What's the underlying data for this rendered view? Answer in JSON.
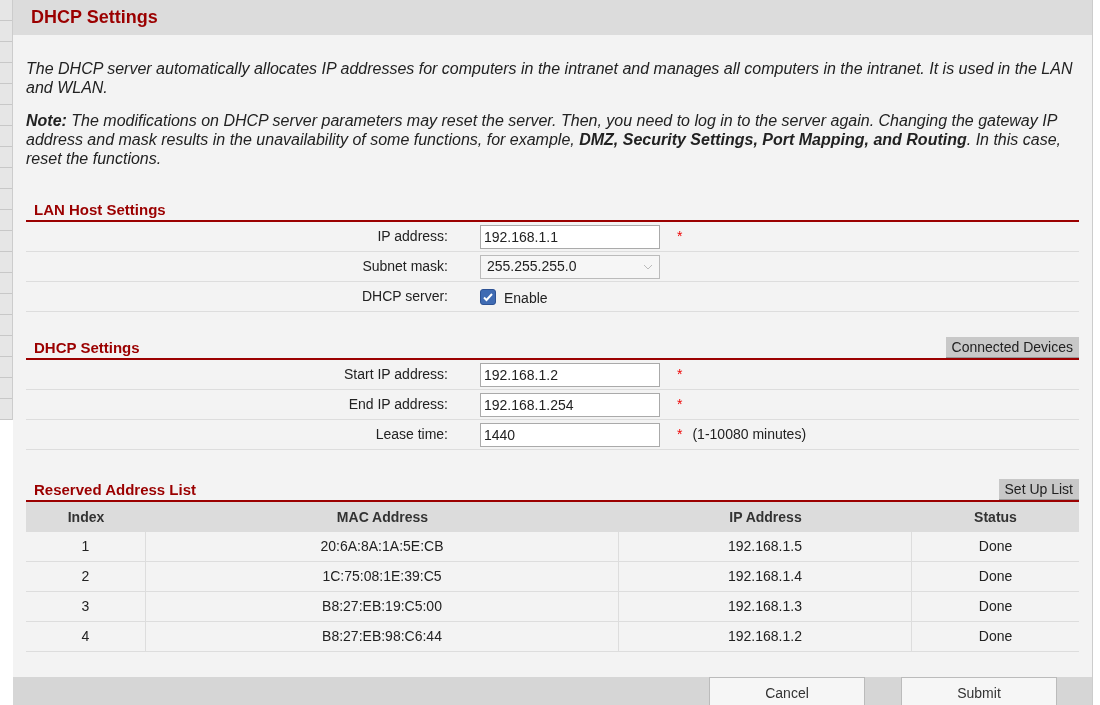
{
  "page_title": "DHCP Settings",
  "intro": "The DHCP server automatically allocates IP addresses for computers in the intranet and manages all computers in the intranet. It is used in the LAN and WLAN.",
  "note": "**Note:** The modifications on DHCP server parameters may reset the server. Then, you need to log in to the server again. Changing the gateway IP address and mask results in the unavailability of some functions, for example, **DMZ, Security Settings, Port Mapping, and Routing**. In this case, reset the functions.",
  "sections": [
    {
      "title": "LAN Host Settings",
      "fields": [
        {
          "kind": "text",
          "label": "IP address:",
          "value": "192.168.1.1",
          "mark": "*"
        },
        {
          "kind": "select",
          "label": "Subnet mask:",
          "value": "255.255.255.0"
        },
        {
          "kind": "checkbox",
          "label": "DHCP server:",
          "value": "Enable",
          "checked": true
        }
      ]
    },
    {
      "title": "DHCP Settings",
      "action": "Connected Devices",
      "fields": [
        {
          "kind": "text",
          "label": "Start IP address:",
          "value": "192.168.1.2",
          "mark": "*"
        },
        {
          "kind": "text",
          "label": "End IP address:",
          "value": "192.168.1.254",
          "mark": "*"
        },
        {
          "kind": "text",
          "label": "Lease time:",
          "value": "1440",
          "mark": "*",
          "hint": "(1-10080 minutes)"
        }
      ]
    }
  ],
  "reserved": {
    "title": "Reserved Address List",
    "action": "Set Up List",
    "columns": [
      "Index",
      "MAC Address",
      "IP Address",
      "Status"
    ],
    "rows": [
      [
        "1",
        "20:6A:8A:1A:5E:CB",
        "192.168.1.5",
        "Done"
      ],
      [
        "2",
        "1C:75:08:1E:39:C5",
        "192.168.1.4",
        "Done"
      ],
      [
        "3",
        "B8:27:EB:19:C5:00",
        "192.168.1.3",
        "Done"
      ],
      [
        "4",
        "B8:27:EB:98:C6:44",
        "192.168.1.2",
        "Done"
      ]
    ]
  },
  "buttons": [
    "Cancel",
    "Submit"
  ]
}
